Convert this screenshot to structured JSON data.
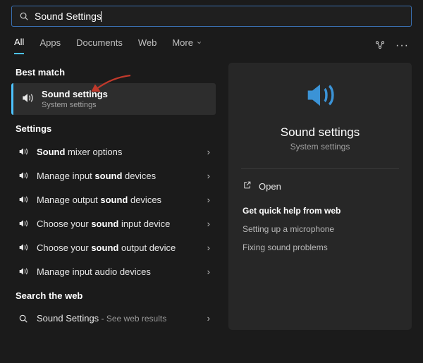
{
  "search": {
    "value": "Sound Settings"
  },
  "tabs": [
    "All",
    "Apps",
    "Documents",
    "Web",
    "More"
  ],
  "sections": {
    "best_match": "Best match",
    "settings": "Settings",
    "search_web": "Search the web"
  },
  "best_match": {
    "title": "Sound settings",
    "subtitle": "System settings"
  },
  "settings_items": [
    {
      "pre": "",
      "bold": "Sound",
      "post": " mixer options"
    },
    {
      "pre": "Manage input ",
      "bold": "sound",
      "post": " devices"
    },
    {
      "pre": "Manage output ",
      "bold": "sound",
      "post": " devices"
    },
    {
      "pre": "Choose your ",
      "bold": "sound",
      "post": " input device"
    },
    {
      "pre": "Choose your ",
      "bold": "sound",
      "post": " output device"
    },
    {
      "pre": "Manage input audio devices",
      "bold": "",
      "post": ""
    }
  ],
  "web_item": {
    "query": "Sound Settings",
    "suffix": " - See web results"
  },
  "detail": {
    "title": "Sound settings",
    "subtitle": "System settings",
    "open": "Open",
    "help_heading": "Get quick help from web",
    "help_links": [
      "Setting up a microphone",
      "Fixing sound problems"
    ]
  },
  "colors": {
    "accent": "#4cc2ff",
    "arrow": "#c0392b"
  }
}
